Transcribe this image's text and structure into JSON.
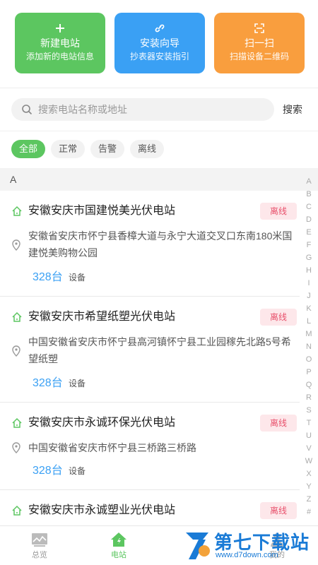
{
  "actions": [
    {
      "title": "新建电站",
      "subtitle": "添加新的电站信息",
      "icon": "plus-icon",
      "color": "#5cc660"
    },
    {
      "title": "安装向导",
      "subtitle": "抄表器安装指引",
      "icon": "link-icon",
      "color": "#3aa0f4"
    },
    {
      "title": "扫一扫",
      "subtitle": "扫描设备二维码",
      "icon": "scan-icon",
      "color": "#f99e3e"
    }
  ],
  "search": {
    "placeholder": "搜索电站名称或地址",
    "button": "搜索"
  },
  "filters": [
    "全部",
    "正常",
    "告警",
    "离线"
  ],
  "active_filter": "全部",
  "section_letter": "A",
  "alphabet": [
    "A",
    "B",
    "C",
    "D",
    "E",
    "F",
    "G",
    "H",
    "I",
    "J",
    "K",
    "L",
    "M",
    "N",
    "O",
    "P",
    "Q",
    "R",
    "S",
    "T",
    "U",
    "V",
    "W",
    "X",
    "Y",
    "Z",
    "#"
  ],
  "stations": [
    {
      "name": "安徽安庆市国建悦美光伏电站",
      "status": "离线",
      "address": "安徽省安庆市怀宁县香樟大道与永宁大道交叉口东南180米国建悦美购物公园",
      "count": "328台",
      "unit": "设备"
    },
    {
      "name": "安徽安庆市希望纸塑光伏电站",
      "status": "离线",
      "address": "中国安徽省安庆市怀宁县高河镇怀宁县工业园稼先北路5号希望纸塑",
      "count": "328台",
      "unit": "设备"
    },
    {
      "name": "安徽安庆市永诚环保光伏电站",
      "status": "离线",
      "address": "中国安徽省安庆市怀宁县三桥路三桥路",
      "count": "328台",
      "unit": "设备"
    },
    {
      "name": "安徽安庆市永诚塑业光伏电站",
      "status": "离线",
      "address": "",
      "count": "",
      "unit": ""
    }
  ],
  "nav": [
    {
      "label": "总览",
      "icon": "chart-icon"
    },
    {
      "label": "电站",
      "icon": "home-icon"
    },
    {
      "label": "",
      "icon": ""
    },
    {
      "label": "我的",
      "icon": "user-icon"
    }
  ],
  "active_tab": "电站",
  "watermark": {
    "title": "第七下载站",
    "url": "www.d7down.com"
  },
  "colors": {
    "accent": "#5cc660",
    "blue": "#3aa0f4",
    "orange": "#f99e3e",
    "offline_bg": "#fde7ea",
    "offline_text": "#e8506b"
  }
}
